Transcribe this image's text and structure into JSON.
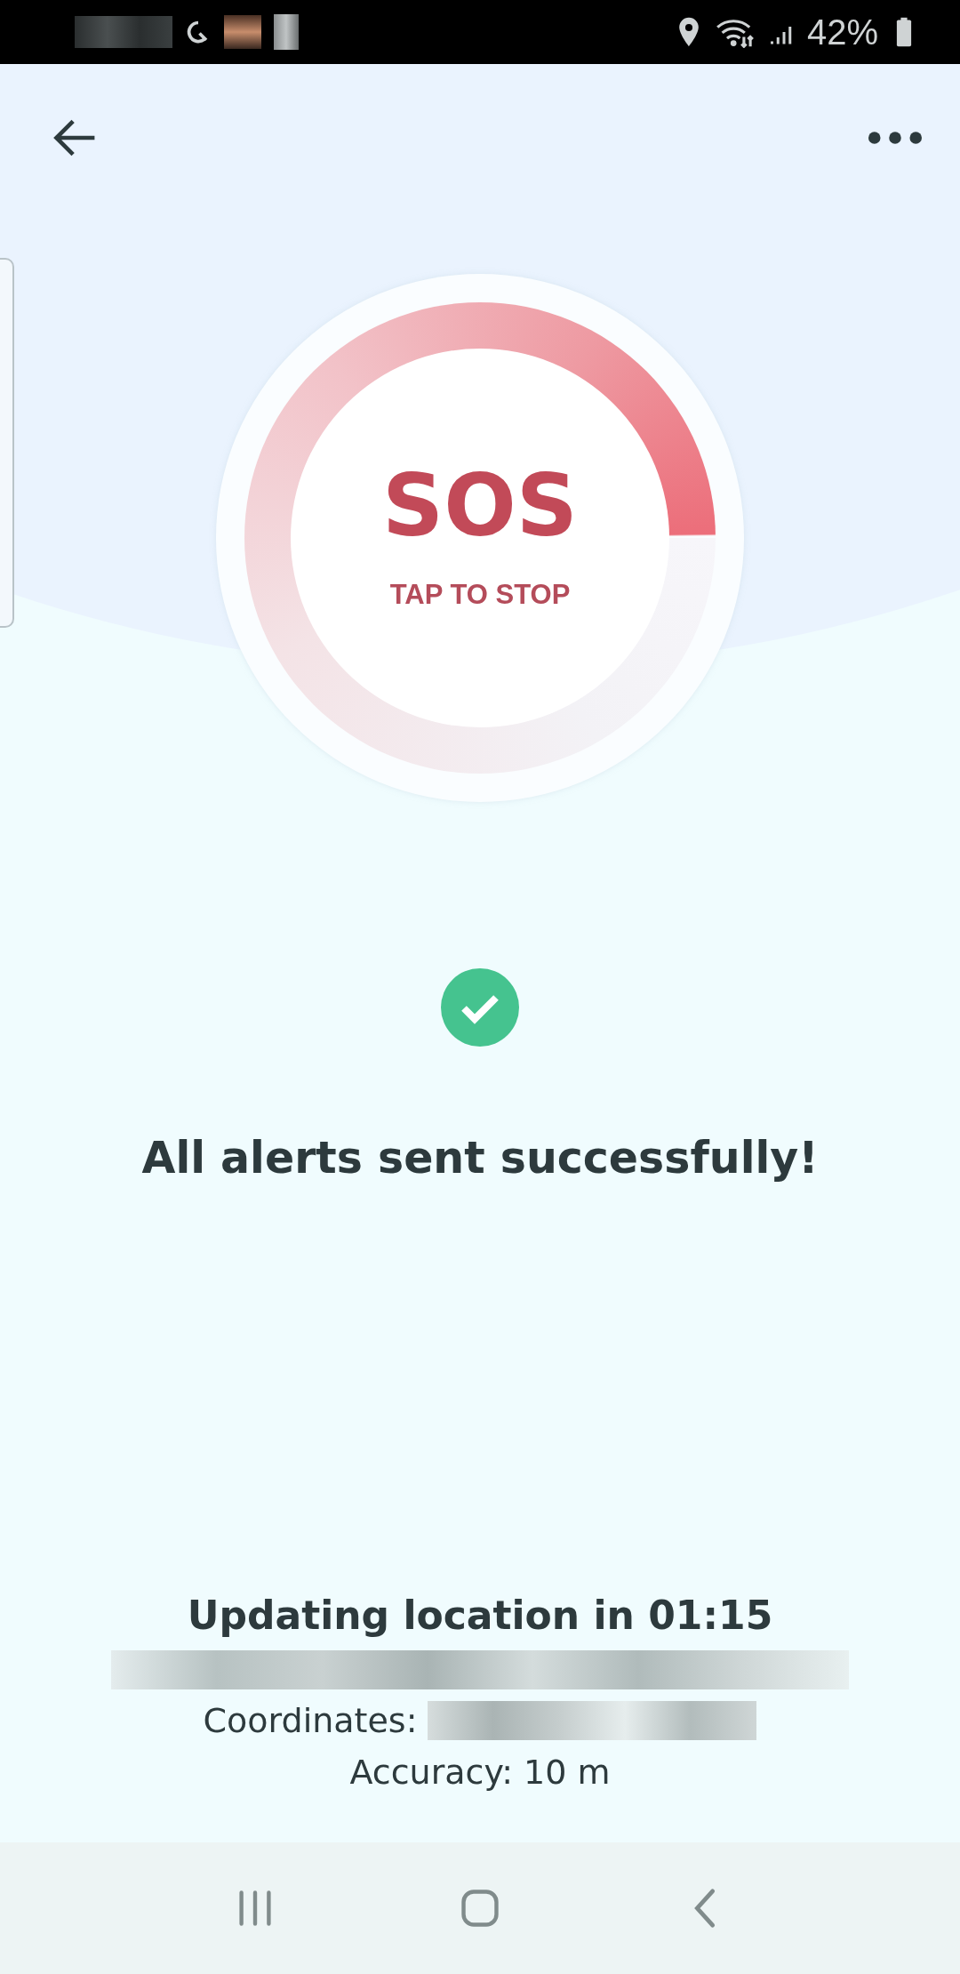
{
  "status_bar": {
    "battery": "42%"
  },
  "sos_button": {
    "title": "SOS",
    "subtitle": "TAP TO STOP"
  },
  "result": {
    "message": "All alerts sent successfully!"
  },
  "location": {
    "title": "Updating location in 01:15",
    "coordinates_label": "Coordinates:",
    "accuracy": "Accuracy: 10 m"
  }
}
